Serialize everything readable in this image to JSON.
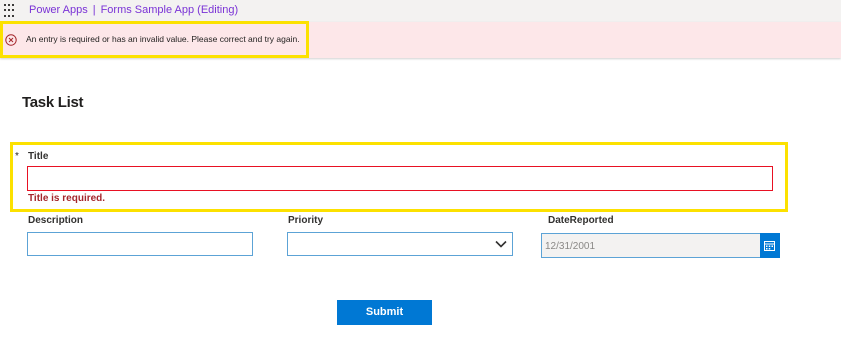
{
  "header": {
    "app_name": "Power Apps",
    "separator": "|",
    "app_title": "Forms Sample App (Editing)"
  },
  "error_banner": {
    "message": "An entry is required or has an invalid value. Please correct and try again.",
    "icon": "error-circle-icon"
  },
  "form": {
    "title": "Task List",
    "fields": {
      "title": {
        "required_marker": "*",
        "label": "Title",
        "value": "",
        "error": "Title is required."
      },
      "description": {
        "label": "Description",
        "value": ""
      },
      "priority": {
        "label": "Priority",
        "value": ""
      },
      "date_reported": {
        "label": "DateReported",
        "value": "12/31/2001"
      }
    },
    "submit_label": "Submit"
  },
  "colors": {
    "accent": "#0078d4",
    "brand": "#7a33d6",
    "error": "#a4262c",
    "error_border": "#e81123",
    "error_banner_bg": "#fde7e9",
    "highlight": "#fce100"
  }
}
